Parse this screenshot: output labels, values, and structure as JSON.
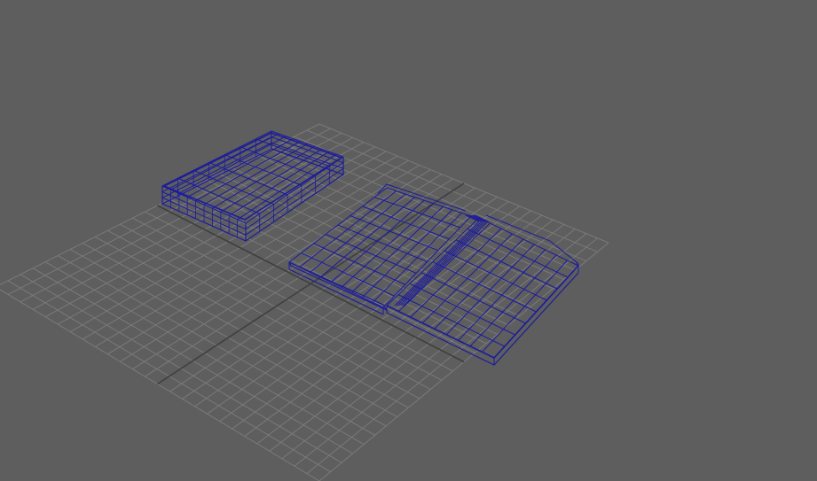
{
  "viewport": {
    "background_color": "#5e5e5e",
    "grid_color": "#7a7a7a",
    "axis_color": "#3f3f3f",
    "wireframe_color": "#1c1c9c"
  },
  "scene": {
    "objects": [
      {
        "name": "closed-book",
        "display": "wireframe"
      },
      {
        "name": "open-book",
        "display": "wireframe"
      }
    ]
  }
}
